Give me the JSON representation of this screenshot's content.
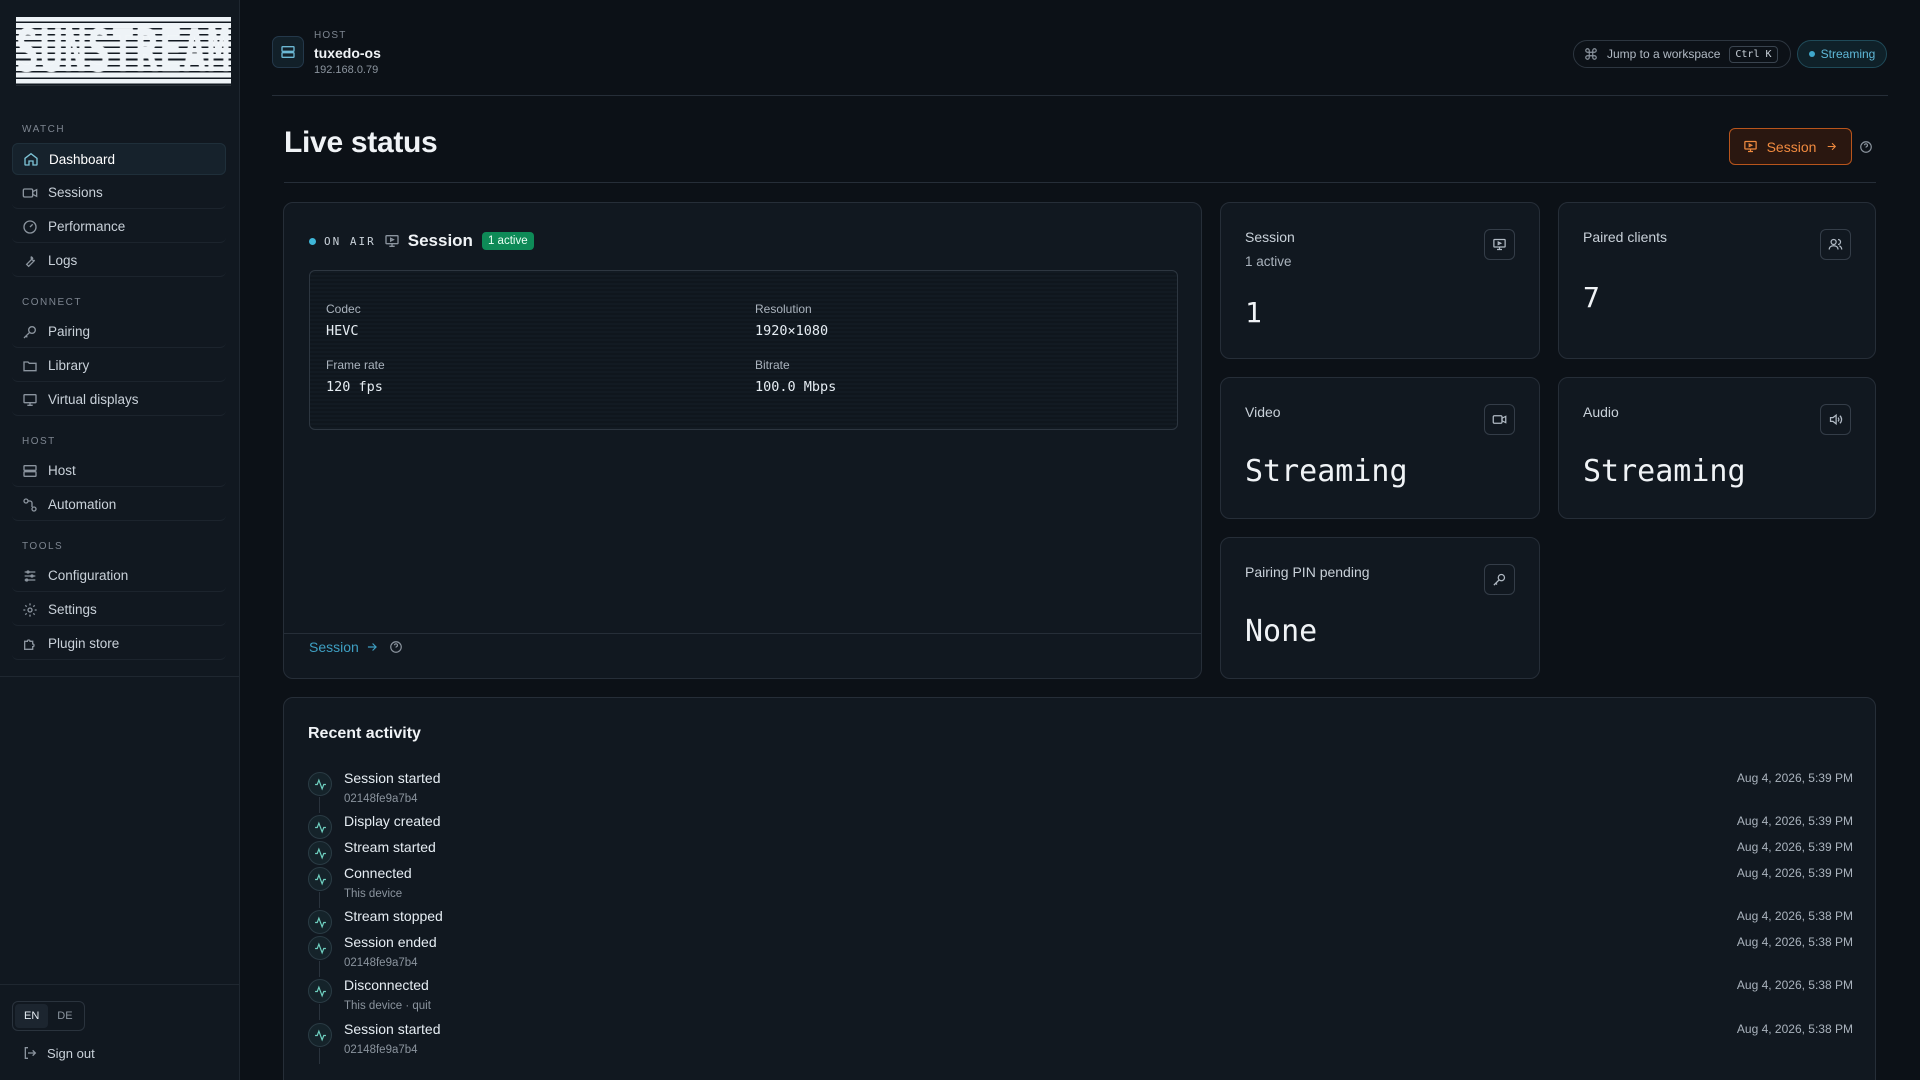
{
  "brand": {
    "logo_text": "SUNSTREAM"
  },
  "sidebar": {
    "sections": [
      {
        "label": "WATCH"
      },
      {
        "label": "CONNECT"
      },
      {
        "label": "HOST"
      },
      {
        "label": "TOOLS"
      }
    ],
    "items": [
      {
        "label": "Dashboard",
        "icon": "home-icon",
        "active": true
      },
      {
        "label": "Sessions",
        "icon": "video-icon"
      },
      {
        "label": "Performance",
        "icon": "gauge-icon"
      },
      {
        "label": "Logs",
        "icon": "wrench-icon"
      },
      {
        "label": "Pairing",
        "icon": "key-icon"
      },
      {
        "label": "Library",
        "icon": "folder-icon"
      },
      {
        "label": "Virtual displays",
        "icon": "monitor-icon"
      },
      {
        "label": "Host",
        "icon": "server-icon"
      },
      {
        "label": "Automation",
        "icon": "workflow-icon"
      },
      {
        "label": "Configuration",
        "icon": "sliders-icon"
      },
      {
        "label": "Settings",
        "icon": "gear-icon"
      },
      {
        "label": "Plugin store",
        "icon": "puzzle-icon"
      }
    ],
    "lang": [
      "EN",
      "DE"
    ],
    "sign_out": "Sign out"
  },
  "header": {
    "host_label": "HOST",
    "host_name": "tuxedo-os",
    "host_ip": "192.168.0.79",
    "jump_label": "Jump to a workspace",
    "jump_shortcut": "Ctrl K",
    "status_pill": "Streaming"
  },
  "page": {
    "title": "Live status",
    "session_button": "Session"
  },
  "live": {
    "onair_label": "ON AIR",
    "title": "Session",
    "badge": "1 active",
    "stats": [
      {
        "label": "Codec",
        "value": "HEVC"
      },
      {
        "label": "Resolution",
        "value": "1920×1080"
      },
      {
        "label": "Frame rate",
        "value": "120 fps"
      },
      {
        "label": "Bitrate",
        "value": "100.0 Mbps"
      }
    ],
    "footer_link": "Session"
  },
  "metrics": {
    "session": {
      "title": "Session",
      "sub": "1 active",
      "value": "1"
    },
    "paired": {
      "title": "Paired clients",
      "value": "7"
    },
    "video": {
      "title": "Video",
      "value": "Streaming"
    },
    "audio": {
      "title": "Audio",
      "value": "Streaming"
    },
    "pin": {
      "title": "Pairing PIN pending",
      "value": "None"
    }
  },
  "activity": {
    "title": "Recent activity",
    "items": [
      {
        "name": "Session started",
        "sub": "02148fe9a7b4",
        "time": "Aug 4, 2026, 5:39 PM"
      },
      {
        "name": "Display created",
        "sub": "",
        "time": "Aug 4, 2026, 5:39 PM"
      },
      {
        "name": "Stream started",
        "sub": "",
        "time": "Aug 4, 2026, 5:39 PM"
      },
      {
        "name": "Connected",
        "sub": "This device",
        "time": "Aug 4, 2026, 5:39 PM"
      },
      {
        "name": "Stream stopped",
        "sub": "",
        "time": "Aug 4, 2026, 5:38 PM"
      },
      {
        "name": "Session ended",
        "sub": "02148fe9a7b4",
        "time": "Aug 4, 2026, 5:38 PM"
      },
      {
        "name": "Disconnected",
        "sub": "This device · quit",
        "time": "Aug 4, 2026, 5:38 PM"
      },
      {
        "name": "Session started",
        "sub": "02148fe9a7b4",
        "time": "Aug 4, 2026, 5:38 PM"
      }
    ]
  },
  "colors": {
    "background": "#0c1117",
    "accent": "#3fa8cc",
    "onair_badge": "#0e8a57",
    "session_button": "#f08a3f"
  }
}
